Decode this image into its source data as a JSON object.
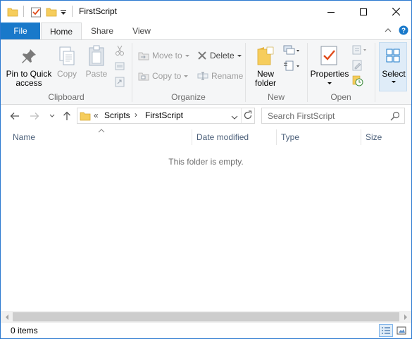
{
  "window": {
    "title": "FirstScript"
  },
  "tabs": {
    "file": "File",
    "home": "Home",
    "share": "Share",
    "view": "View"
  },
  "ribbon": {
    "clipboard": {
      "label": "Clipboard",
      "pin_line1": "Pin to Quick",
      "pin_line2": "access",
      "copy": "Copy",
      "paste": "Paste"
    },
    "organize": {
      "label": "Organize",
      "move_to": "Move to",
      "copy_to": "Copy to",
      "delete": "Delete",
      "rename": "Rename"
    },
    "new": {
      "label": "New",
      "new_folder_line1": "New",
      "new_folder_line2": "folder"
    },
    "open": {
      "label": "Open",
      "properties": "Properties"
    },
    "select": {
      "label": "Select"
    }
  },
  "address": {
    "overflow": "«",
    "crumbs": [
      "Scripts",
      "FirstScript"
    ],
    "separator": "›"
  },
  "search": {
    "placeholder": "Search FirstScript"
  },
  "columns": [
    "Name",
    "Date modified",
    "Type",
    "Size"
  ],
  "content": {
    "empty_message": "This folder is empty."
  },
  "status": {
    "items": "0 items"
  },
  "colors": {
    "accent": "#1979ca",
    "folder": "#f6cd5c",
    "border": "#2b79d0"
  }
}
